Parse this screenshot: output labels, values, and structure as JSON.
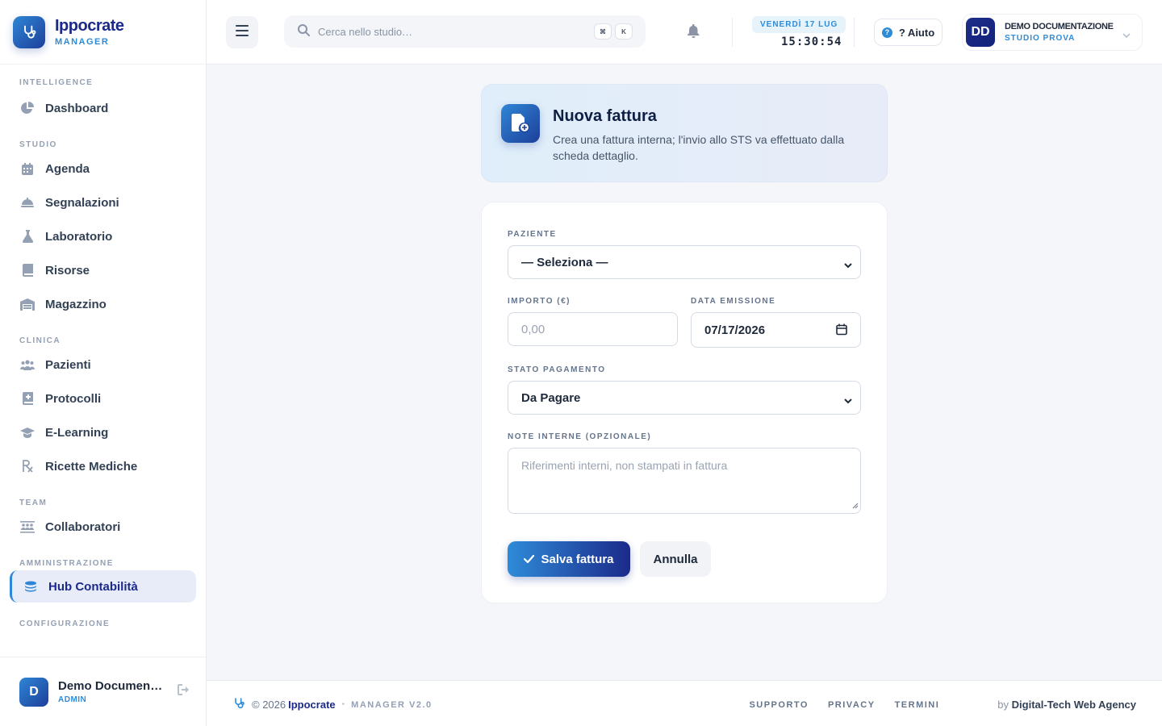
{
  "brand": {
    "name": "Ippocrate",
    "subtitle": "MANAGER"
  },
  "sidebar": {
    "sections": [
      {
        "title": "INTELLIGENCE",
        "items": [
          {
            "label": "Dashboard",
            "icon": "pie-chart-icon"
          }
        ]
      },
      {
        "title": "STUDIO",
        "items": [
          {
            "label": "Agenda",
            "icon": "calendar-icon"
          },
          {
            "label": "Segnalazioni",
            "icon": "bell-service-icon"
          },
          {
            "label": "Laboratorio",
            "icon": "flask-icon"
          },
          {
            "label": "Risorse",
            "icon": "book-icon"
          },
          {
            "label": "Magazzino",
            "icon": "warehouse-icon"
          }
        ]
      },
      {
        "title": "CLINICA",
        "items": [
          {
            "label": "Pazienti",
            "icon": "users-icon"
          },
          {
            "label": "Protocolli",
            "icon": "medical-book-icon"
          },
          {
            "label": "E-Learning",
            "icon": "graduation-cap-icon"
          },
          {
            "label": "Ricette Mediche",
            "icon": "prescription-icon"
          }
        ]
      },
      {
        "title": "TEAM",
        "items": [
          {
            "label": "Collaboratori",
            "icon": "team-icon"
          }
        ]
      },
      {
        "title": "AMMINISTRAZIONE",
        "items": [
          {
            "label": "Hub Contabilità",
            "icon": "coins-icon",
            "active": true
          }
        ]
      },
      {
        "title": "CONFIGURAZIONE",
        "items": []
      }
    ],
    "user": {
      "initial": "D",
      "name": "Demo Documentazione",
      "role": "ADMIN"
    }
  },
  "header": {
    "search_placeholder": "Cerca nello studio…",
    "kbd1": "⌘",
    "kbd2": "K",
    "date": "VENERDÌ 17 LUG",
    "time": "15:30:54",
    "help_label": "? Aiuto",
    "profile_initials": "DD",
    "profile_name": "DEMO DOCUMENTAZIONE",
    "profile_sub": "STUDIO PROVA"
  },
  "hero": {
    "title": "Nuova fattura",
    "description": "Crea una fattura interna; l'invio allo STS va effettuato dalla scheda dettaglio."
  },
  "form": {
    "patient_label": "PAZIENTE",
    "patient_value": "— Seleziona —",
    "amount_label": "IMPORTO (€)",
    "amount_placeholder": "0,00",
    "date_label": "DATA EMISSIONE",
    "date_value": "07/17/2026",
    "status_label": "STATO PAGAMENTO",
    "status_value": "Da Pagare",
    "notes_label": "NOTE INTERNE (OPZIONALE)",
    "notes_placeholder": "Riferimenti interni, non stampati in fattura",
    "save_label": "Salva fattura",
    "cancel_label": "Annulla"
  },
  "footer": {
    "copyright": "© 2026",
    "brand": "Ippocrate",
    "version": "MANAGER V2.0",
    "links": [
      "SUPPORTO",
      "PRIVACY",
      "TERMINI"
    ],
    "by_prefix": "by",
    "agency": "Digital-Tech Web Agency"
  },
  "colors": {
    "accent": "#2e8bd8",
    "brand": "#1b2a8a",
    "background": "#f5f6fa"
  }
}
